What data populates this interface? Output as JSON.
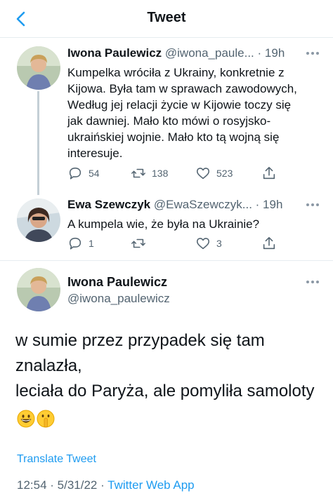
{
  "header": {
    "title": "Tweet"
  },
  "tweets": [
    {
      "name": "Iwona Paulewicz",
      "handle": "@iwona_paule...",
      "time": "· 19h",
      "lines": [
        "Kumpelka wróciła z Ukrainy, konkretnie z",
        "Kijowa. Była tam w sprawach zawodowych,",
        "Według jej relacji życie w Kijowie toczy się",
        "jak dawniej. Mało kto mówi o rosyjsko-",
        "ukraińskiej wojnie. Mało kto tą wojną się",
        "interesuje."
      ],
      "replies": "54",
      "retweets": "138",
      "likes": "523"
    },
    {
      "name": "Ewa Szewczyk",
      "handle": "@EwaSzewczyk...",
      "time": "· 19h",
      "lines": [
        "A kumpela wie, że była na Ukrainie?"
      ],
      "replies": "1",
      "retweets": "",
      "likes": "3"
    }
  ],
  "main_tweet": {
    "name": "Iwona Paulewicz",
    "handle": "@iwona_paulewicz",
    "lines": [
      "w sumie przez przypadek się tam",
      "znalazła,",
      "leciała do Paryża, ale pomyliła samoloty"
    ],
    "emojis": [
      "grinning-face",
      "shushing-face"
    ],
    "translate_label": "Translate Tweet",
    "timestamp": "12:54 · 5/31/22 · ",
    "source_app": "Twitter Web App"
  },
  "colors": {
    "accent": "#1d9bf0",
    "secondary_text": "#536471",
    "divider": "#e6ecf0"
  }
}
